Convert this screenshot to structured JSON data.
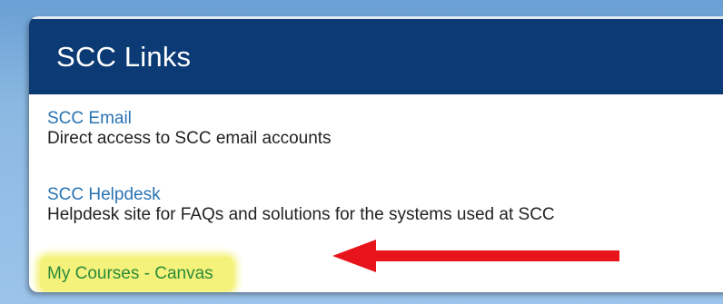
{
  "panel": {
    "title": "SCC Links"
  },
  "links": [
    {
      "title": "SCC Email",
      "description": "Direct access to SCC email accounts"
    },
    {
      "title": "SCC Helpdesk",
      "description": "Helpdesk site for FAQs and solutions for the systems used at SCC"
    },
    {
      "title": "My Courses - Canvas"
    }
  ],
  "colors": {
    "header_bg": "#0b3a74",
    "link": "#2873b4",
    "highlight": "#f4f27a",
    "arrow": "#e8141b"
  },
  "annotations": {
    "arrow_icon": "left-arrow-icon"
  }
}
